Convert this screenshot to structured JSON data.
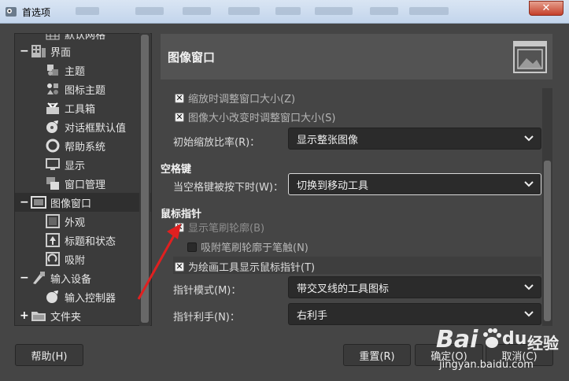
{
  "window": {
    "title": "首选项",
    "close_glyph": "✕"
  },
  "tree": {
    "items": [
      {
        "label": "默认网格",
        "icon": "grid-icon"
      },
      {
        "label": "界面",
        "icon": "interface-icon",
        "expander": "−"
      },
      {
        "label": "主题",
        "icon": "theme-icon"
      },
      {
        "label": "图标主题",
        "icon": "icon-theme-icon"
      },
      {
        "label": "工具箱",
        "icon": "toolbox-icon"
      },
      {
        "label": "对话框默认值",
        "icon": "dialog-defaults-icon"
      },
      {
        "label": "帮助系统",
        "icon": "help-system-icon"
      },
      {
        "label": "显示",
        "icon": "display-icon"
      },
      {
        "label": "窗口管理",
        "icon": "window-management-icon"
      },
      {
        "label": "图像窗口",
        "icon": "image-window-icon",
        "expander": "−",
        "selected": true
      },
      {
        "label": "外观",
        "icon": "appearance-icon"
      },
      {
        "label": "标题和状态",
        "icon": "title-status-icon"
      },
      {
        "label": "吸附",
        "icon": "snapping-icon"
      },
      {
        "label": "输入设备",
        "icon": "input-devices-icon",
        "expander": "−"
      },
      {
        "label": "输入控制器",
        "icon": "input-controllers-icon"
      },
      {
        "label": "文件夹",
        "icon": "folders-icon",
        "expander": "+"
      }
    ]
  },
  "header": {
    "title": "图像窗口",
    "icon": "image-window-large-icon"
  },
  "content": {
    "resize_on_zoom": "缩放时调整窗口大小(Z)",
    "resize_on_image_change": "图像大小改变时调整窗口大小(S)",
    "initial_zoom_label": "初始缩放比率(R)：",
    "initial_zoom_value": "显示整张图像",
    "space_section": "空格键",
    "space_label": "当空格键被按下时(W)：",
    "space_value": "切换到移动工具",
    "pointer_section": "鼠标指针",
    "show_brush_outline": "显示笔刷轮廓(B)",
    "snap_brush_outline": "吸附笔刷轮廓于笔触(N)",
    "show_pointer_for_paint": "为绘画工具显示鼠标指针(T)",
    "pointer_mode_label": "指针模式(M)：",
    "pointer_mode_value": "带交叉线的工具图标",
    "handedness_label": "指针利手(N)：",
    "handedness_value": "右利手",
    "check_glyph": "✕"
  },
  "buttons": {
    "help": "帮助(H)",
    "reset": "重置(R)",
    "ok": "确定(O)",
    "cancel": "取消(C)"
  },
  "watermark": {
    "brand": "Bai",
    "brand_suffix": "du",
    "product": "经验",
    "url": "jingyan.baidu.com"
  },
  "colors": {
    "window_bg": "#454545",
    "panel_bg": "#3b3b3b",
    "arrow": "#e02020",
    "titlebar": "#c3d5ec",
    "close": "#c5402a"
  }
}
